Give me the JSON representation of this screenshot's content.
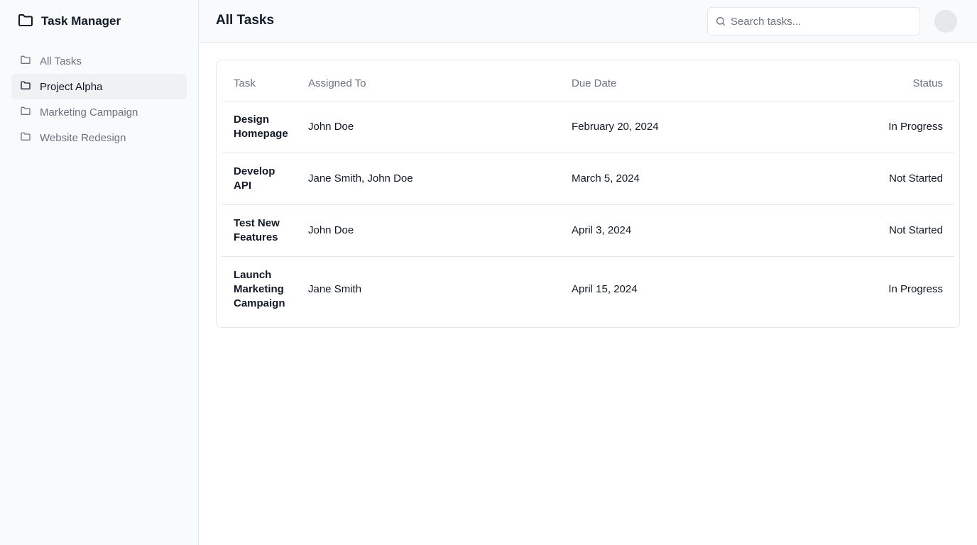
{
  "app": {
    "title": "Task Manager",
    "logo_icon": "folder-icon"
  },
  "sidebar": {
    "items": [
      {
        "label": "All Tasks",
        "icon": "folder-icon",
        "active": false
      },
      {
        "label": "Project Alpha",
        "icon": "folder-icon",
        "active": true
      },
      {
        "label": "Marketing Campaign",
        "icon": "folder-icon",
        "active": false
      },
      {
        "label": "Website Redesign",
        "icon": "folder-icon",
        "active": false
      }
    ]
  },
  "header": {
    "title": "All Tasks",
    "search": {
      "placeholder": "Search tasks...",
      "value": "",
      "icon": "search-icon"
    }
  },
  "table": {
    "columns": [
      "Task",
      "Assigned To",
      "Due Date",
      "Status"
    ],
    "rows": [
      {
        "task": "Design Homepage",
        "assigned": "John Doe",
        "due": "February 20, 2024",
        "status": "In Progress"
      },
      {
        "task": "Develop API",
        "assigned": "Jane Smith, John Doe",
        "due": "March 5, 2024",
        "status": "Not Started"
      },
      {
        "task": "Test New Features",
        "assigned": "John Doe",
        "due": "April 3, 2024",
        "status": "Not Started"
      },
      {
        "task": "Launch Marketing Campaign",
        "assigned": "Jane Smith",
        "due": "April 15, 2024",
        "status": "In Progress"
      }
    ]
  },
  "colors": {
    "sidebar_bg": "#f9fafb",
    "active_item_bg": "#f0f1f3",
    "border": "#e5e7eb",
    "muted_text": "#6b7280",
    "text": "#111827"
  }
}
